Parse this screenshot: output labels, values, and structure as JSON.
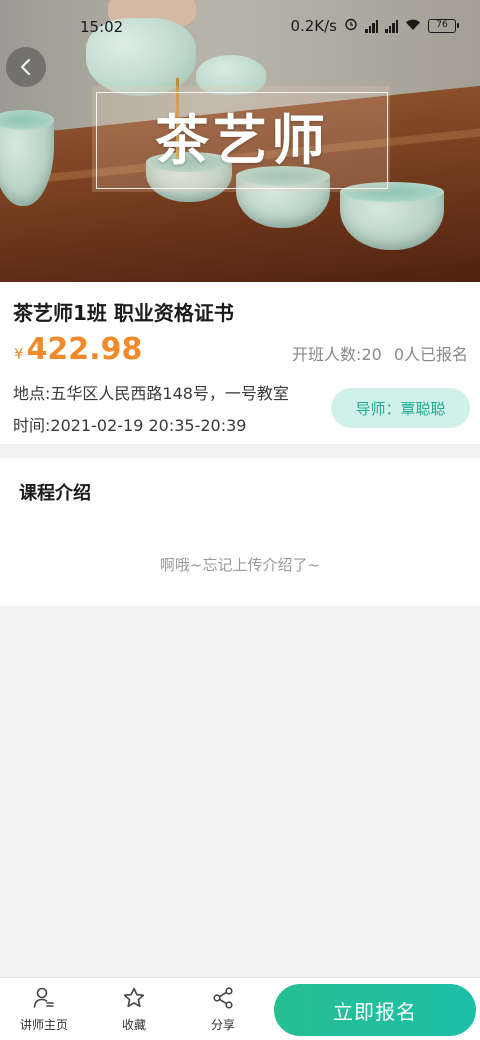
{
  "status_bar": {
    "time": "15:02",
    "network_speed": "0.2K/s",
    "battery": "76"
  },
  "hero": {
    "banner_title": "茶艺师",
    "back_icon": "chevron-left-icon"
  },
  "course": {
    "name": "茶艺师1班 职业资格证书",
    "currency_symbol": "¥",
    "price": "422.98",
    "capacity": "开班人数:20",
    "enrolled": "0人已报名",
    "location": "地点:五华区人民西路148号，一号教室",
    "time": "时间:2021-02-19 20:35-20:39",
    "tutor": "导师：覃聪聪"
  },
  "intro": {
    "title": "课程介绍",
    "empty_text": "啊哦~忘记上传介绍了~"
  },
  "bottom_bar": {
    "tabs": [
      {
        "label": "讲师主页",
        "icon": "teacher-profile-icon"
      },
      {
        "label": "收藏",
        "icon": "star-icon"
      },
      {
        "label": "分享",
        "icon": "share-icon"
      }
    ],
    "signup_label": "立即报名"
  },
  "colors": {
    "price": "#f08a2a",
    "accent": "#1fae93",
    "tutor_bg": "#d2f0ea",
    "signup_start": "#27bf92",
    "signup_end": "#1dbfa8",
    "page_bg": "#f2f2f2"
  }
}
